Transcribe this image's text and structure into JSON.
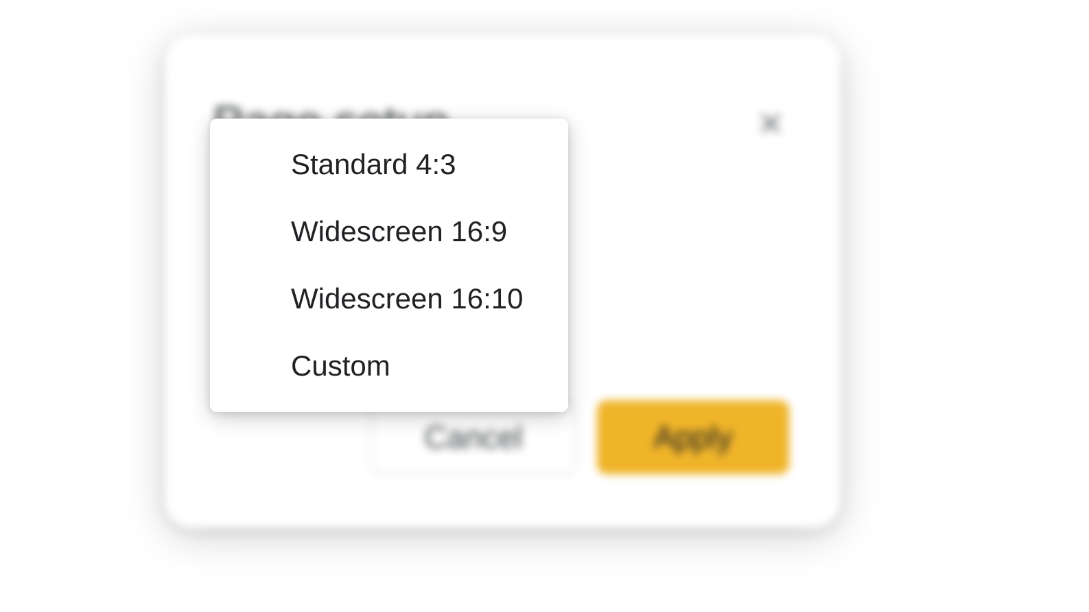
{
  "dialog": {
    "title": "Page setup",
    "buttons": {
      "cancel": "Cancel",
      "apply": "Apply"
    }
  },
  "dropdown": {
    "options": [
      "Standard 4:3",
      "Widescreen 16:9",
      "Widescreen 16:10",
      "Custom"
    ]
  }
}
